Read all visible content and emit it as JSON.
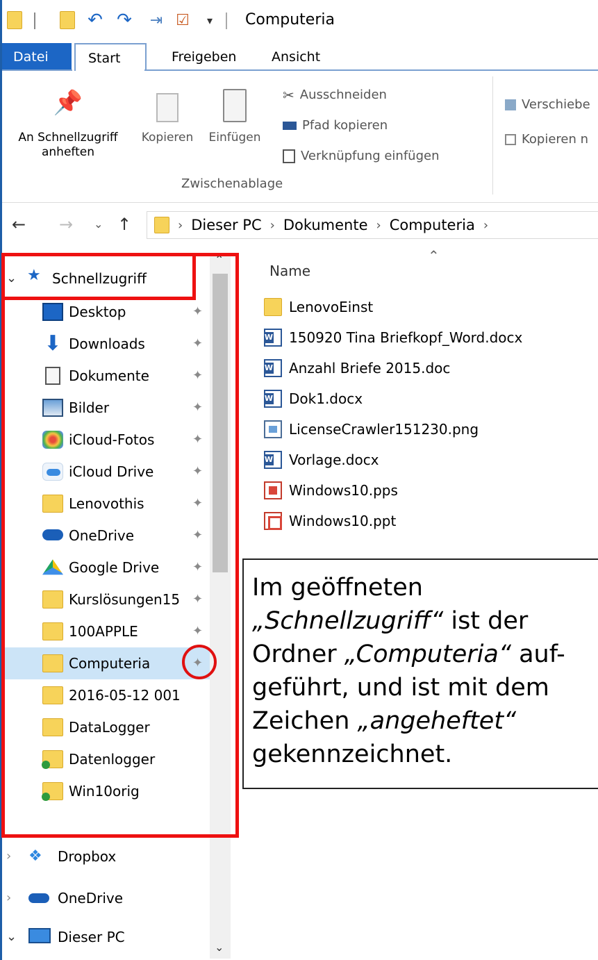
{
  "window": {
    "title": "Computeria"
  },
  "tabs": [
    {
      "label": "Datei"
    },
    {
      "label": "Start"
    },
    {
      "label": "Freigeben"
    },
    {
      "label": "Ansicht"
    }
  ],
  "ribbon": {
    "pin_label_line1": "An Schnellzugriff",
    "pin_label_line2": "anheften",
    "copy_label": "Kopieren",
    "paste_label": "Einfügen",
    "cut_label": "Ausschneiden",
    "copy_path_label": "Pfad kopieren",
    "paste_shortcut_label": "Verknüpfung einfügen",
    "move_label": "Verschiebe",
    "copy_to_label": "Kopieren n",
    "group_label": "Zwischenablage"
  },
  "address": {
    "crumbs": [
      "Dieser PC",
      "Dokumente",
      "Computeria"
    ]
  },
  "nav": {
    "quick_access": "Schnellzugriff",
    "pinned": [
      {
        "label": "Desktop",
        "icon": "desktop-icon",
        "pinned": true
      },
      {
        "label": "Downloads",
        "icon": "downloads-icon",
        "pinned": true
      },
      {
        "label": "Dokumente",
        "icon": "documents-icon",
        "pinned": true
      },
      {
        "label": "Bilder",
        "icon": "pictures-icon",
        "pinned": true
      },
      {
        "label": "iCloud-Fotos",
        "icon": "icloud-photos-icon",
        "pinned": true
      },
      {
        "label": "iCloud Drive",
        "icon": "icloud-drive-icon",
        "pinned": true
      },
      {
        "label": "Lenovothis",
        "icon": "folder-icon",
        "pinned": true
      },
      {
        "label": "OneDrive",
        "icon": "onedrive-icon",
        "pinned": true
      },
      {
        "label": "Google Drive",
        "icon": "google-drive-icon",
        "pinned": true
      },
      {
        "label": "Kurslösungen15",
        "icon": "folder-icon",
        "pinned": true
      },
      {
        "label": "100APPLE",
        "icon": "folder-icon",
        "pinned": true
      },
      {
        "label": "Computeria",
        "icon": "folder-icon",
        "pinned": true,
        "selected": true
      },
      {
        "label": "2016-05-12 001",
        "icon": "folder-icon",
        "pinned": false
      },
      {
        "label": "DataLogger",
        "icon": "folder-icon",
        "pinned": false
      },
      {
        "label": "Datenlogger",
        "icon": "folder-icon",
        "pinned": false
      },
      {
        "label": "Win10orig",
        "icon": "folder-icon",
        "pinned": false
      }
    ],
    "roots": [
      {
        "label": "Dropbox",
        "icon": "dropbox-icon"
      },
      {
        "label": "OneDrive",
        "icon": "onedrive-icon"
      },
      {
        "label": "Dieser PC",
        "icon": "this-pc-icon"
      }
    ]
  },
  "files": {
    "column_name": "Name",
    "items": [
      {
        "name": "LenovoEinst",
        "type": "folder"
      },
      {
        "name": "150920 Tina Briefkopf_Word.docx",
        "type": "word"
      },
      {
        "name": "Anzahl Briefe 2015.doc",
        "type": "word"
      },
      {
        "name": "Dok1.docx",
        "type": "word"
      },
      {
        "name": "LicenseCrawler151230.png",
        "type": "png"
      },
      {
        "name": "Vorlage.docx",
        "type": "word"
      },
      {
        "name": "Windows10.pps",
        "type": "pps"
      },
      {
        "name": "Windows10.ppt",
        "type": "ppt"
      }
    ]
  },
  "annotation": {
    "t1": "Im geöffneten",
    "t2": "„Schnellzugriff“",
    "t3": " ist der",
    "t4": "Ordner ",
    "t5": "„Computeria“",
    "t6": " auf-",
    "t7": "geführt, und ist mit dem",
    "t8": "Zeichen ",
    "t9": "„angeheftet“",
    "t10": "gekennzeichnet."
  },
  "colors": {
    "accent": "#1c66c5",
    "highlight": "#ee1111",
    "selection": "#cce4f7",
    "folder": "#f7d35a"
  }
}
